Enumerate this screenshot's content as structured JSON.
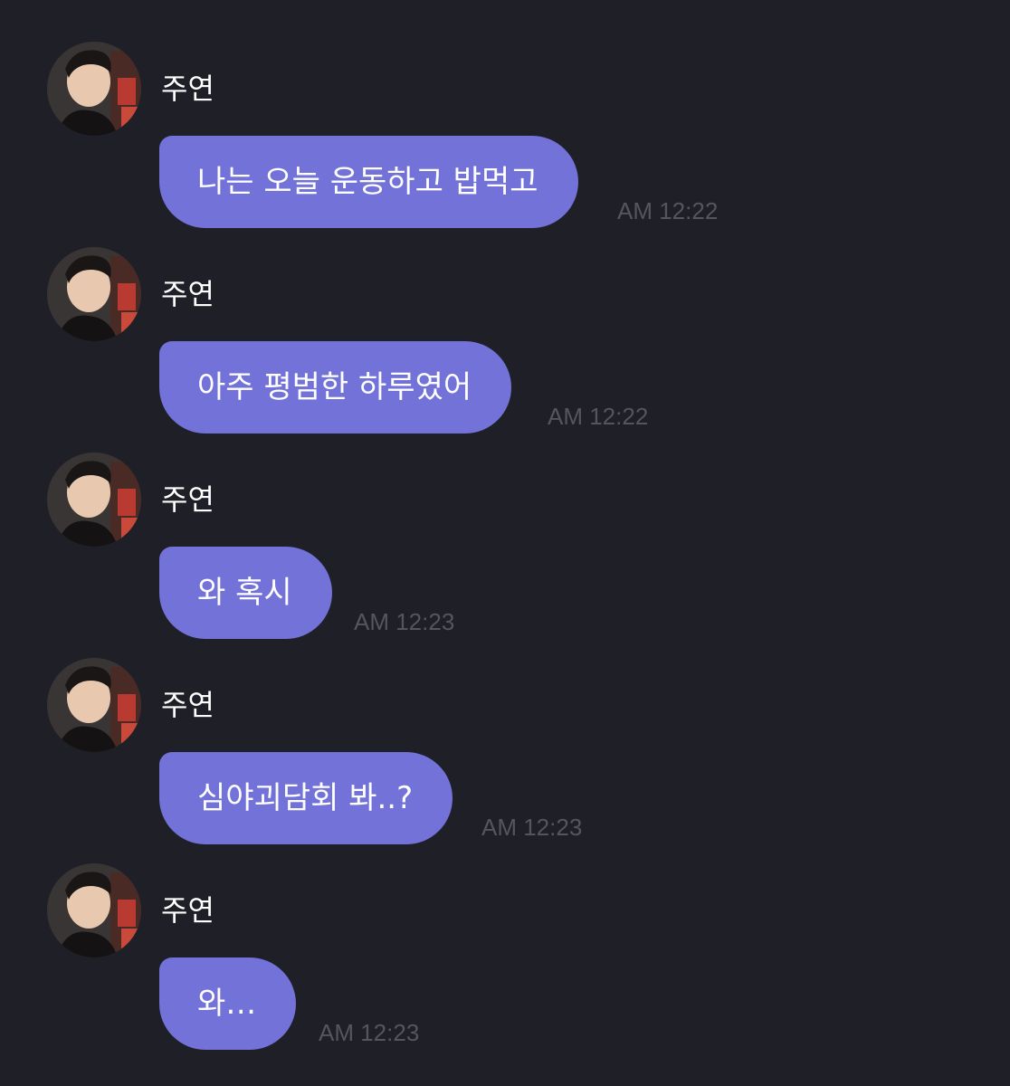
{
  "conversation": {
    "messages": [
      {
        "sender": "주연",
        "text": "나는 오늘 운동하고 밥먹고",
        "time": "AM 12:22"
      },
      {
        "sender": "주연",
        "text": "아주 평범한 하루였어",
        "time": "AM 12:22"
      },
      {
        "sender": "주연",
        "text": "와 혹시",
        "time": "AM 12:23"
      },
      {
        "sender": "주연",
        "text": "심야괴담회 봐..?",
        "time": "AM 12:23"
      },
      {
        "sender": "주연",
        "text": "와…",
        "time": "AM 12:23"
      }
    ]
  },
  "colors": {
    "background": "#1f1f27",
    "bubble": "#7272d8",
    "timestamp": "#55555e",
    "text": "#ffffff"
  }
}
